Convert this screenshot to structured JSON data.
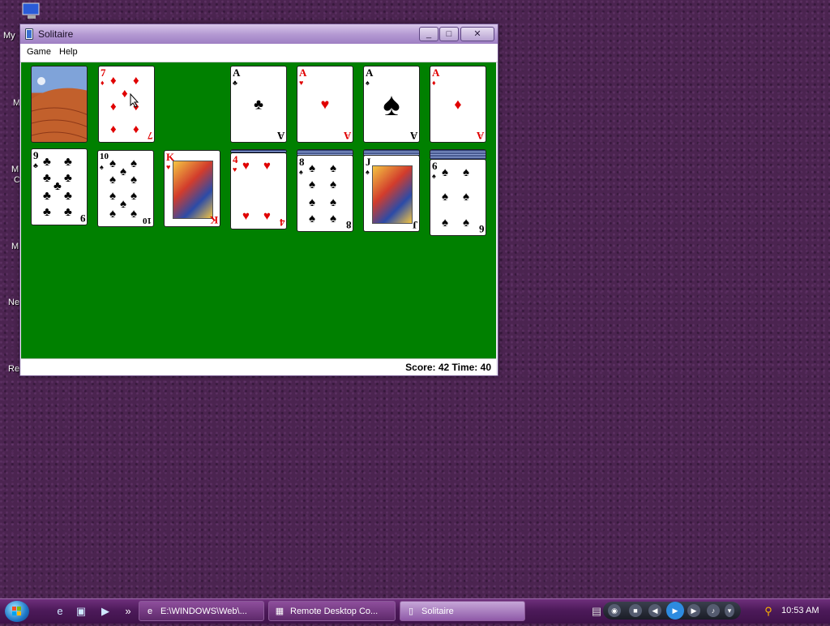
{
  "desktop": {
    "labels": [
      "My",
      "M",
      "M",
      "C",
      "M",
      "Ne",
      "Re"
    ]
  },
  "window": {
    "title": "Solitaire",
    "controls": {
      "minimize": "_",
      "maximize": "□",
      "close": "✕"
    }
  },
  "menu": [
    "Game",
    "Help"
  ],
  "status": "Score: 42  Time: 40",
  "cards": {
    "stock": {
      "face": "back-desert"
    },
    "waste": {
      "rank": "7",
      "suit": "♦"
    },
    "foundations": [
      {
        "rank": "A",
        "suit": "♣"
      },
      {
        "rank": "A",
        "suit": "♥"
      },
      {
        "rank": "A",
        "suit": "♠"
      },
      {
        "rank": "A",
        "suit": "♦"
      }
    ],
    "tableau": [
      {
        "rank": "9",
        "suit": "♣",
        "hidden": 0
      },
      {
        "rank": "10",
        "suit": "♠",
        "hidden": 0
      },
      {
        "rank": "K",
        "suit": "♥",
        "hidden": 0
      },
      {
        "rank": "4",
        "suit": "♥",
        "hidden": 1
      },
      {
        "rank": "8",
        "suit": "♠",
        "hidden": 2
      },
      {
        "rank": "J",
        "suit": "♠",
        "hidden": 2
      },
      {
        "rank": "6",
        "suit": "♠",
        "hidden": 3
      }
    ]
  },
  "taskbar": {
    "tasks": [
      "E:\\WINDOWS\\Web\\...",
      "Remote Desktop Co...",
      "Solitaire"
    ],
    "overflow": "»",
    "clock": "10:53 AM"
  }
}
